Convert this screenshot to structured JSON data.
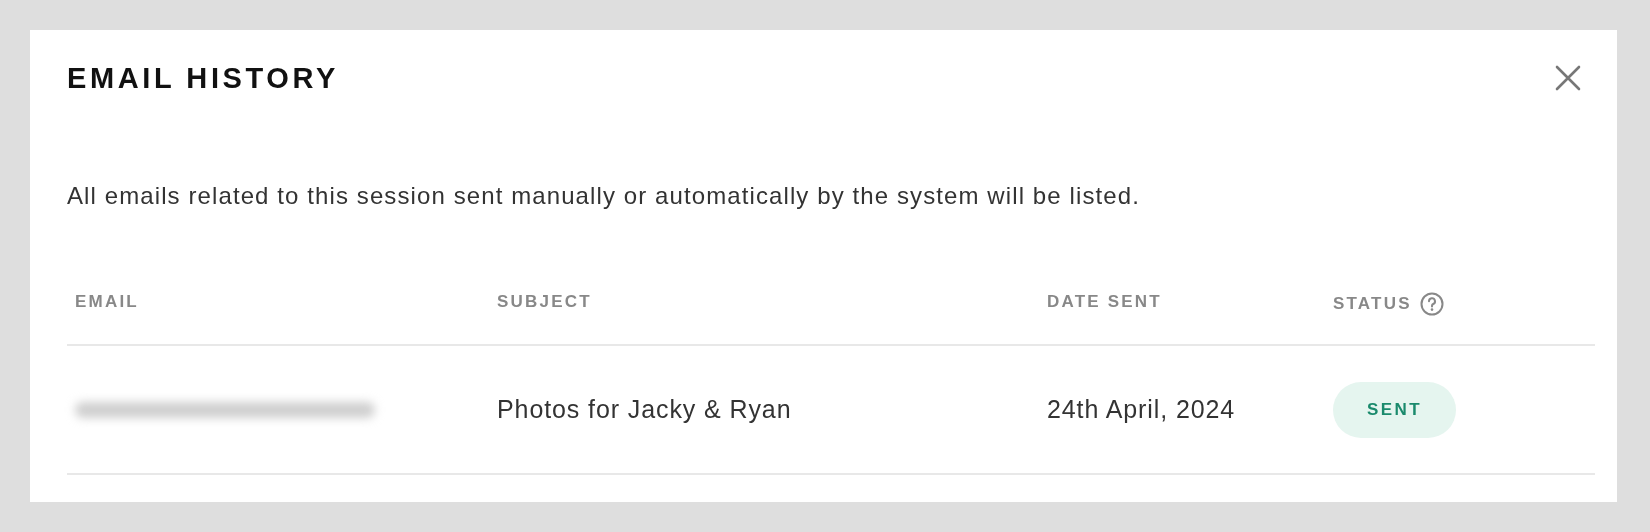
{
  "dialog": {
    "title": "EMAIL HISTORY",
    "description": "All emails related to this session sent manually or automatically by the system will be listed."
  },
  "table": {
    "columns": [
      "EMAIL",
      "SUBJECT",
      "DATE SENT",
      "STATUS"
    ],
    "rows": [
      {
        "email_blurred": true,
        "subject": "Photos for Jacky & Ryan",
        "date_sent": "24th April, 2024",
        "status": {
          "label": "SENT",
          "kind": "sent"
        }
      }
    ]
  }
}
